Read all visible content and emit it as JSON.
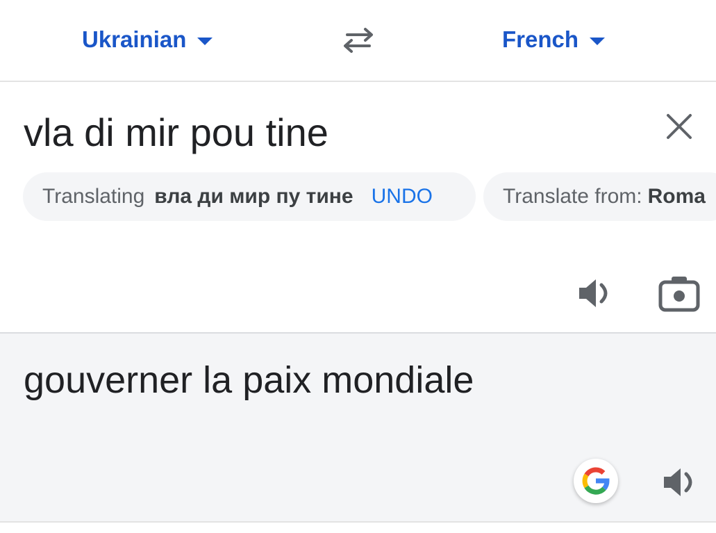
{
  "languages": {
    "source": "Ukrainian",
    "target": "French"
  },
  "input": {
    "text": "vla di mir pou tine"
  },
  "suggestions": {
    "translating_prefix": "Translating",
    "translating_text": "вла ди мир пу тине",
    "undo_label": "UNDO",
    "translate_from_prefix": "Translate from:",
    "translate_from_lang": "Roma"
  },
  "output": {
    "text": "gouverner la paix mondiale"
  },
  "icons": {
    "swap": "swap-arrows-icon",
    "clear": "close-icon",
    "speaker": "speaker-icon",
    "camera": "camera-icon",
    "google": "google-g-icon"
  },
  "colors": {
    "accent": "#1a56c8",
    "link": "#1a73e8",
    "output_bg": "#f4f5f7",
    "chip_bg": "#f4f5f7",
    "icon_gray": "#5f6368"
  }
}
